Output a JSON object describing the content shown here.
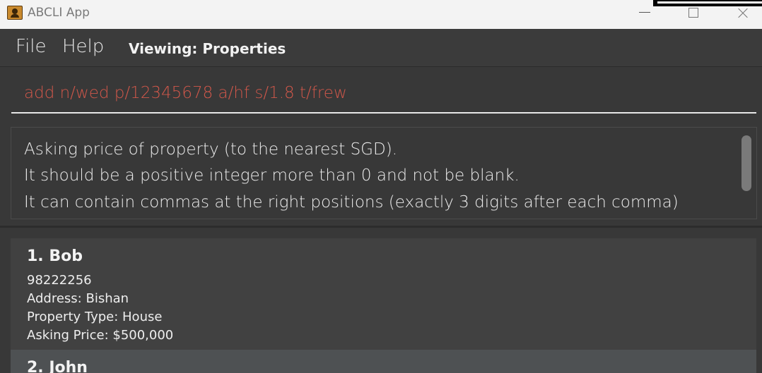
{
  "window": {
    "title": "ABCLI App"
  },
  "menu": {
    "file": "File",
    "help": "Help",
    "viewing": "Viewing: Properties"
  },
  "command": {
    "value": "add n/wed p/12345678 a/hf s/1.8 t/frew"
  },
  "result": {
    "lines": [
      "Asking price of property (to the nearest SGD).",
      "It should be a positive integer more than 0 and not be blank.",
      "It can contain commas at the right positions (exactly 3 digits after each comma)"
    ]
  },
  "list": {
    "items": [
      {
        "name": "1. Bob",
        "phone": "98222256",
        "address": "Address: Bishan",
        "type": "Property Type: House",
        "price": "Asking Price: $500,000"
      },
      {
        "name": "2. John"
      }
    ]
  },
  "icons": {
    "app": "contact-book-icon",
    "minimize": "minimize-icon",
    "maximize": "maximize-icon",
    "close": "close-icon"
  },
  "colors": {
    "background": "#383838",
    "command_text": "#d0574a",
    "card": "#414141",
    "card_selected": "#4e5153"
  }
}
